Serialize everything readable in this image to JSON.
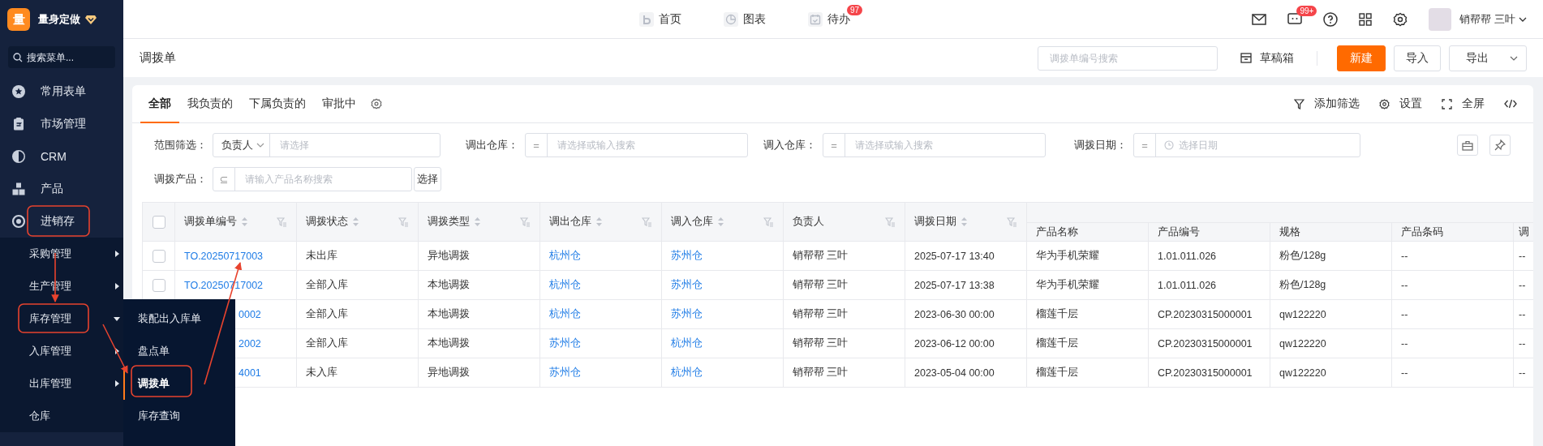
{
  "app": {
    "logo": "量",
    "name": "量身定做",
    "search_placeholder": "搜索菜单..."
  },
  "sidebar": {
    "items": [
      {
        "label": "常用表单"
      },
      {
        "label": "市场管理"
      },
      {
        "label": "CRM"
      },
      {
        "label": "产品"
      },
      {
        "label": "进销存",
        "expanded": true,
        "children": [
          {
            "label": "采购管理",
            "expanded": false
          },
          {
            "label": "生产管理",
            "expanded": false
          },
          {
            "label": "库存管理",
            "expanded": true,
            "children": [
              {
                "label": "装配出入库单",
                "selected": false
              },
              {
                "label": "盘点单",
                "selected": false
              },
              {
                "label": "调拨单",
                "selected": true
              },
              {
                "label": "库存查询",
                "selected": false
              }
            ]
          },
          {
            "label": "入库管理",
            "expanded": false
          },
          {
            "label": "出库管理",
            "expanded": false
          },
          {
            "label": "仓库"
          }
        ]
      }
    ]
  },
  "topnav": [
    {
      "label": "首页"
    },
    {
      "label": "图表"
    },
    {
      "label": "待办",
      "badge": "97"
    }
  ],
  "topbar": {
    "message_badge": "99+",
    "user": "销帮帮 三叶"
  },
  "page": {
    "title": "调拨单",
    "search_placeholder": "调拨单编号搜索",
    "drafts": "草稿箱",
    "new": "新建",
    "import": "导入",
    "export": "导出"
  },
  "tabs": [
    {
      "label": "全部",
      "selected": true
    },
    {
      "label": "我负责的",
      "selected": false
    },
    {
      "label": "下属负责的",
      "selected": false
    },
    {
      "label": "审批中",
      "selected": false
    }
  ],
  "toolbar": {
    "add_filter": "添加筛选",
    "settings": "设置",
    "fullscreen": "全屏"
  },
  "filters": [
    {
      "kind": "scope",
      "label": "范围筛选：",
      "field": "负责人",
      "placeholder": "请选择"
    },
    {
      "kind": "operator",
      "label": "调出仓库：",
      "operator": "=",
      "placeholder": "请选择或输入搜索"
    },
    {
      "kind": "operator",
      "label": "调入仓库：",
      "operator": "=",
      "placeholder": "请选择或输入搜索"
    },
    {
      "kind": "date",
      "label": "调拨日期：",
      "operator": "=",
      "placeholder": "选择日期"
    },
    {
      "kind": "product",
      "label": "调拨产品：",
      "operator": "⊆",
      "placeholder": "请输入产品名称搜索",
      "button": "选择"
    }
  ],
  "table": {
    "select_all_checked": false,
    "columns": [
      {
        "label": "调拨单编号",
        "sort": true,
        "filter": true
      },
      {
        "label": "调拨状态",
        "sort": true,
        "filter": true
      },
      {
        "label": "调拨类型",
        "sort": true,
        "filter": true
      },
      {
        "label": "调出仓库",
        "sort": true,
        "filter": true
      },
      {
        "label": "调入仓库",
        "sort": true,
        "filter": true
      },
      {
        "label": "负责人",
        "sort": false,
        "filter": true
      },
      {
        "label": "调拨日期",
        "sort": true,
        "filter": true
      }
    ],
    "product_columns": [
      "产品名称",
      "产品编号",
      "规格",
      "产品条码",
      "调"
    ],
    "rows": [
      {
        "checked": false,
        "covered": false,
        "id": "TO.20250717003",
        "status": "未出库",
        "type": "异地调拨",
        "from": "杭州仓",
        "to": "苏州仓",
        "owner": "销帮帮 三叶",
        "date": "2025-07-17 13:40",
        "product": [
          "华为手机荣耀",
          "1.01.011.026",
          "粉色/128g",
          "--",
          "--"
        ]
      },
      {
        "checked": false,
        "covered": false,
        "id": "TO.20250717002",
        "status": "全部入库",
        "type": "本地调拨",
        "from": "杭州仓",
        "to": "苏州仓",
        "owner": "销帮帮 三叶",
        "date": "2025-07-17 13:38",
        "product": [
          "华为手机荣耀",
          "1.01.011.026",
          "粉色/128g",
          "--",
          "--"
        ]
      },
      {
        "covered": true,
        "id": "0002",
        "status": "全部入库",
        "type": "本地调拨",
        "from": "杭州仓",
        "to": "苏州仓",
        "owner": "销帮帮 三叶",
        "date": "2023-06-30 00:00",
        "product": [
          "榴莲千层",
          "CP.20230315000001",
          "qw122220",
          "--",
          "--"
        ]
      },
      {
        "covered": true,
        "id": "2002",
        "status": "全部入库",
        "type": "本地调拨",
        "from": "苏州仓",
        "to": "杭州仓",
        "owner": "销帮帮 三叶",
        "date": "2023-06-12 00:00",
        "product": [
          "榴莲千层",
          "CP.20230315000001",
          "qw122220",
          "--",
          "--"
        ]
      },
      {
        "covered": true,
        "id": "4001",
        "status": "未入库",
        "type": "异地调拨",
        "from": "苏州仓",
        "to": "杭州仓",
        "owner": "销帮帮 三叶",
        "date": "2023-05-04 00:00",
        "product": [
          "榴莲千层",
          "CP.20230315000001",
          "qw122220",
          "--",
          "--"
        ]
      }
    ]
  }
}
